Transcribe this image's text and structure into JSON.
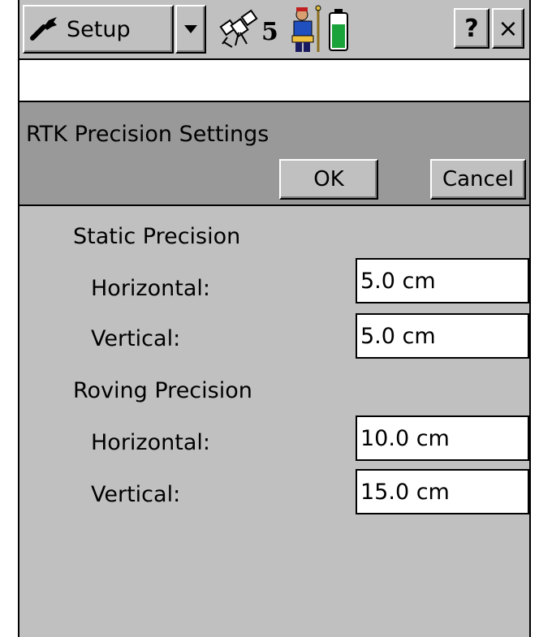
{
  "toolbar": {
    "menu_label": "Setup",
    "menu_icon": "wrench-icon",
    "dropdown_icon": "chevron-down-icon",
    "satellite_count": "5",
    "help_label": "?",
    "close_label": "×"
  },
  "form": {
    "title": "RTK Precision Settings",
    "ok_label": "OK",
    "cancel_label": "Cancel"
  },
  "static": {
    "heading": "Static Precision",
    "horizontal_label": "Horizontal:",
    "horizontal_value": "5.0 cm",
    "vertical_label": "Vertical:",
    "vertical_value": "5.0 cm"
  },
  "roving": {
    "heading": "Roving Precision",
    "horizontal_label": "Horizontal:",
    "horizontal_value": "10.0 cm",
    "vertical_label": "Vertical:",
    "vertical_value": "15.0 cm"
  },
  "colors": {
    "background": "#c0c0c0",
    "header": "#999999",
    "battery_level": "#1aa33a"
  }
}
